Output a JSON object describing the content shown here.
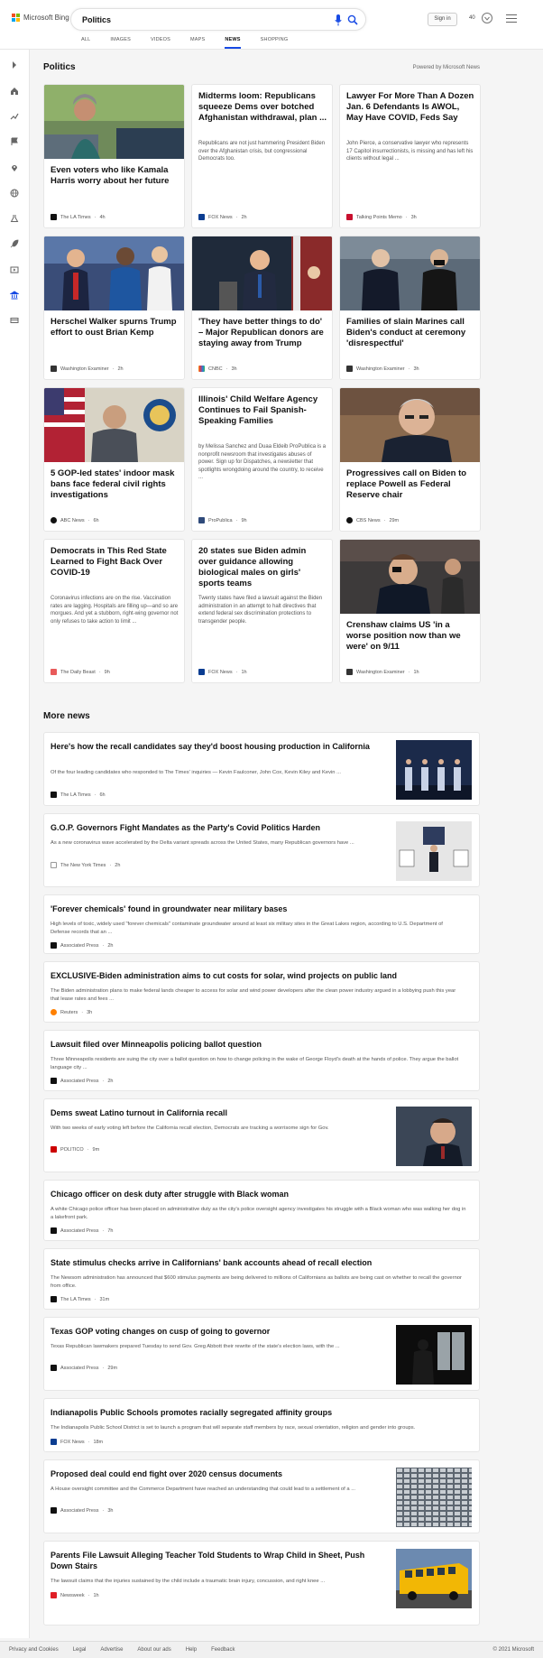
{
  "header": {
    "logo_text": "Microsoft Bing",
    "search_query": "Politics",
    "signin_label": "Sign in",
    "rewards_count": "40",
    "tabs": [
      {
        "label": "ALL"
      },
      {
        "label": "IMAGES"
      },
      {
        "label": "VIDEOS"
      },
      {
        "label": "MAPS"
      },
      {
        "label": "NEWS"
      },
      {
        "label": "SHOPPING"
      }
    ],
    "active_tab": "NEWS",
    "accent_color": "#174ae4"
  },
  "rail_icons": [
    "expand-arrow-icon",
    "home-icon",
    "trending-icon",
    "flag-icon",
    "location-icon",
    "globe-icon",
    "science-icon",
    "rocket-icon",
    "movies-icon",
    "politics-icon",
    "money-icon"
  ],
  "section": {
    "title": "Politics",
    "powered_by": "Powered by Microsoft News"
  },
  "cards": [
    {
      "title": "Even voters who like Kamala Harris worry about her future",
      "snippet": "",
      "source": "The LA Times",
      "time": "4h",
      "image": "photo-woman-parking-lot"
    },
    {
      "title": "Midterms loom: Republicans squeeze Dems over botched Afghanistan withdrawal, plan ...",
      "snippet": "Republicans are not just hammering President Biden over the Afghanistan crisis, but congressional Democrats too.",
      "source": "FOX News",
      "time": "2h",
      "image": ""
    },
    {
      "title": "Lawyer For More Than A Dozen Jan. 6 Defendants Is AWOL, May Have COVID, Feds Say",
      "snippet": "John Pierce, a conservative lawyer who represents 17 Capitol insurrectionists, is missing and has left his clients without legal ...",
      "source": "Talking Points Memo",
      "time": "3h",
      "image": ""
    },
    {
      "title": "Herschel Walker spurns Trump effort to oust Brian Kemp",
      "snippet": "",
      "source": "Washington Examiner",
      "time": "2h",
      "image": "photo-trump-walker"
    },
    {
      "title": "'They have better things to do' – Major Republican donors are staying away from Trump",
      "snippet": "",
      "source": "CNBC",
      "time": "3h",
      "image": "photo-trump-podium"
    },
    {
      "title": "Families of slain Marines call Biden's conduct at ceremony 'disrespectful'",
      "snippet": "",
      "source": "Washington Examiner",
      "time": "3h",
      "image": "photo-biden-ceremony"
    },
    {
      "title": "5 GOP-led states' indoor mask bans face federal civil rights investigations",
      "snippet": "",
      "source": "ABC News",
      "time": "6h",
      "image": "photo-official-flags"
    },
    {
      "title": "Illinois' Child Welfare Agency Continues to Fail Spanish-Speaking Families",
      "snippet": "by Melissa Sanchez and Duaa Eldeib ProPublica is a nonprofit newsroom that investigates abuses of power. Sign up for Dispatches, a newsletter that spotlights wrongdoing around the country, to receive ...",
      "source": "ProPublica",
      "time": "9h",
      "image": ""
    },
    {
      "title": "Progressives call on Biden to replace Powell as Federal Reserve chair",
      "snippet": "",
      "source": "CBS News",
      "time": "29m",
      "image": "photo-powell"
    },
    {
      "title": "Democrats in This Red State Learned to Fight Back Over COVID-19",
      "snippet": "Coronavirus infections are on the rise. Vaccination rates are lagging. Hospitals are filling up—and so are morgues. And yet a stubborn, right-wing governor not only refuses to take action to limit ...",
      "source": "The Daily Beast",
      "time": "9h",
      "image": ""
    },
    {
      "title": "20 states sue Biden admin over guidance allowing biological males on girls' sports teams",
      "snippet": "Twenty states have filed a lawsuit against the Biden administration in an attempt to halt directives that extend federal sex discrimination protections to transgender people.",
      "source": "FOX News",
      "time": "1h",
      "image": ""
    },
    {
      "title": "Crenshaw claims US 'in a worse position now than we were' on 9/11",
      "snippet": "",
      "source": "Washington Examiner",
      "time": "1h",
      "image": "photo-crenshaw"
    }
  ],
  "more_news": {
    "title": "More news",
    "items": [
      {
        "title": "Here's how the recall candidates say they'd boost housing production in California",
        "snippet": "Of the four leading candidates who responded to The Times' inquiries — Kevin Faulconer, John Cox, Kevin Kiley and Kevin ...",
        "source": "The LA Times",
        "time": "6h"
      },
      {
        "title": "G.O.P. Governors Fight Mandates as the Party's Covid Politics Harden",
        "snippet": "As a new coronavirus wave accelerated by the Delta variant spreads across the United States, many Republican governors have ...",
        "source": "The New York Times",
        "time": "2h"
      },
      {
        "title": "'Forever chemicals' found in groundwater near military bases",
        "snippet": "High levels of toxic, widely used \"forever chemicals\" contaminate groundwater around at least six military sites in the Great Lakes region, according to U.S. Department of Defense records that an ...",
        "source": "Associated Press",
        "time": "2h"
      },
      {
        "title": "EXCLUSIVE-Biden administration aims to cut costs for solar, wind projects on public land",
        "snippet": "The Biden administration plans to make federal lands cheaper to access for solar and wind power developers after the clean power industry argued in a lobbying push this year that lease rates and fees ...",
        "source": "Reuters",
        "time": "3h"
      },
      {
        "title": "Lawsuit filed over Minneapolis policing ballot question",
        "snippet": "Three Minneapolis residents are suing the city over a ballot question on how to change policing in the wake of George Floyd's death at the hands of police. They argue the ballot language city ...",
        "source": "Associated Press",
        "time": "2h"
      },
      {
        "title": "Dems sweat Latino turnout in California recall",
        "snippet": "With two weeks of early voting left before the California recall election, Democrats are tracking a worrisome sign for Gov.",
        "source": "POLITICO",
        "time": "9m"
      },
      {
        "title": "Chicago officer on desk duty after struggle with Black woman",
        "snippet": "A white Chicago police officer has been placed on administrative duty as the city's police oversight agency investigates his struggle with a Black woman who was walking her dog in a lakefront park.",
        "source": "Associated Press",
        "time": "7h"
      },
      {
        "title": "State stimulus checks arrive in Californians' bank accounts ahead of recall election",
        "snippet": "The Newsom administration has announced that $600 stimulus payments are being delivered to millions of Californians as ballots are being cast on whether to recall the governor from office.",
        "source": "The LA Times",
        "time": "31m"
      },
      {
        "title": "Texas GOP voting changes on cusp of going to governor",
        "snippet": "Texas Republican lawmakers prepared Tuesday to send Gov. Greg Abbott their rewrite of the state's election laws, with the ...",
        "source": "Associated Press",
        "time": "29m"
      },
      {
        "title": "Indianapolis Public Schools promotes racially segregated affinity groups",
        "snippet": "The Indianapolis Public School District is set to launch a program that will separate staff members by race, sexual orientation, religion and gender into groups.",
        "source": "FOX News",
        "time": "18m"
      },
      {
        "title": "Proposed deal could end fight over 2020 census documents",
        "snippet": "A House oversight committee and the Commerce Department have reached an understanding that could lead to a settlement of a ...",
        "source": "Associated Press",
        "time": "3h"
      },
      {
        "title": "Parents File Lawsuit Alleging Teacher Told Students to Wrap Child in Sheet, Push Down Stairs",
        "snippet": "The lawsuit claims that the injuries sustained by the child include a traumatic brain injury, concussion, and right knee ...",
        "source": "Newsweek",
        "time": "1h"
      }
    ]
  },
  "footer": {
    "links": [
      "Privacy and Cookies",
      "Legal",
      "Advertise",
      "About our ads",
      "Help",
      "Feedback"
    ],
    "copyright": "© 2021 Microsoft"
  }
}
